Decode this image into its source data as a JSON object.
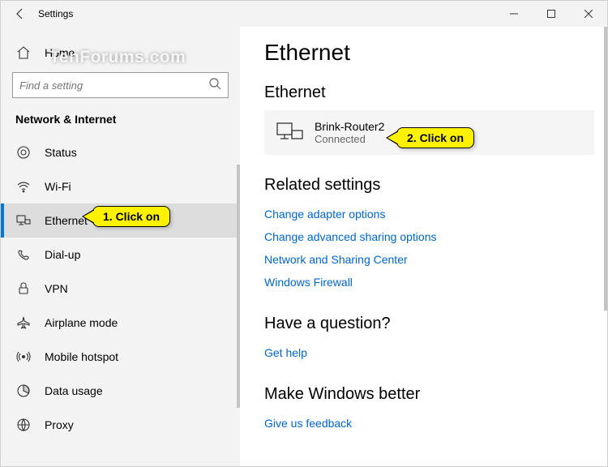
{
  "titlebar": {
    "title": "Settings"
  },
  "sidebar": {
    "home": "Home",
    "search_placeholder": "Find a setting",
    "section": "Network & Internet",
    "items": [
      {
        "label": "Status"
      },
      {
        "label": "Wi-Fi"
      },
      {
        "label": "Ethernet"
      },
      {
        "label": "Dial-up"
      },
      {
        "label": "VPN"
      },
      {
        "label": "Airplane mode"
      },
      {
        "label": "Mobile hotspot"
      },
      {
        "label": "Data usage"
      },
      {
        "label": "Proxy"
      }
    ]
  },
  "main": {
    "heading": "Ethernet",
    "subheading": "Ethernet",
    "connection": {
      "name": "Brink-Router2",
      "status": "Connected"
    },
    "related_heading": "Related settings",
    "related_links": [
      "Change adapter options",
      "Change advanced sharing options",
      "Network and Sharing Center",
      "Windows Firewall"
    ],
    "question_heading": "Have a question?",
    "question_link": "Get help",
    "better_heading": "Make Windows better",
    "better_link": "Give us feedback"
  },
  "callouts": {
    "c1": "1. Click on",
    "c2": "2. Click on"
  },
  "watermark": "TenForums.com"
}
